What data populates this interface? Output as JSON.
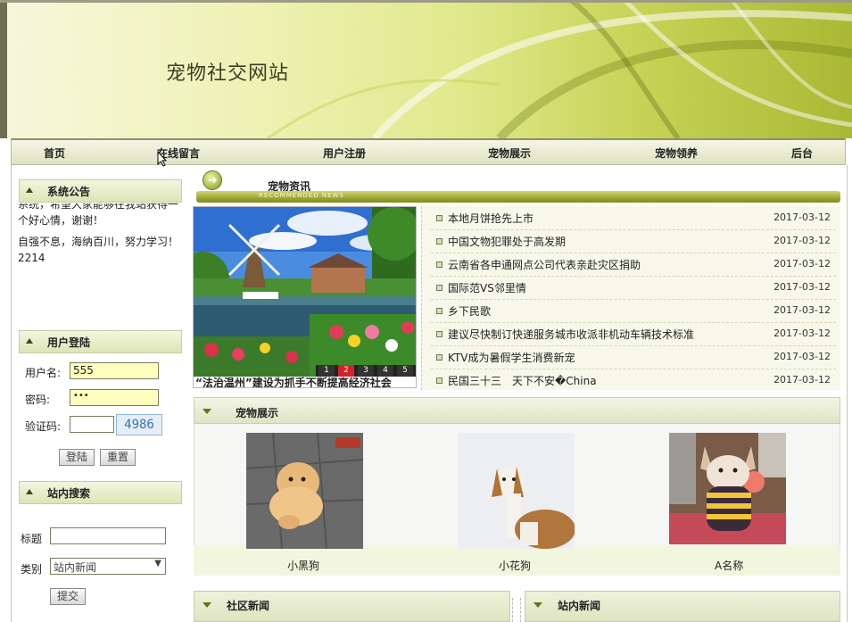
{
  "site_title": "宠物社交网站",
  "nav": [
    "首页",
    "在线留言",
    "用户注册",
    "宠物展示",
    "宠物领养",
    "后台"
  ],
  "sidebar": {
    "notice": {
      "title": "系统公告",
      "lines": [
        "系统，希望大家能够在我站获得一个好心情，谢谢！",
        "自强不息，海纳百川，努力学习！2214"
      ]
    },
    "login": {
      "title": "用户登陆",
      "username_label": "用户名:",
      "username_value": "555",
      "password_label": "密码:",
      "password_value": "•••",
      "captcha_label": "验证码:",
      "captcha_value": "",
      "captcha_code": "4986",
      "login_button": "登陆",
      "reset_button": "重置"
    },
    "search": {
      "title": "站内搜索",
      "title_label": "标题",
      "title_value": "",
      "category_label": "类别",
      "category_value": "站内新闻",
      "submit_button": "提交"
    }
  },
  "news": {
    "title": "宠物资讯",
    "subtitle": "RECOMMENDED NEWS",
    "slide_caption": "“法治温州”建设为抓手不断提高经济社会",
    "slide_pages": [
      "1",
      "2",
      "3",
      "4",
      "5"
    ],
    "slide_active": "2",
    "items": [
      {
        "title": "本地月饼抢先上市",
        "date": "2017-03-12"
      },
      {
        "title": "中国文物犯罪处于高发期",
        "date": "2017-03-12"
      },
      {
        "title": "云南省各申通网点公司代表亲赴灾区捐助",
        "date": "2017-03-12"
      },
      {
        "title": "国际范VS邻里情",
        "date": "2017-03-12"
      },
      {
        "title": "乡下民歌",
        "date": "2017-03-12"
      },
      {
        "title": "建议尽快制订快递服务城市收派非机动车辆技术标准",
        "date": "2017-03-12"
      },
      {
        "title": "KTV成为暑假学生消费新宠",
        "date": "2017-03-12"
      },
      {
        "title": "民国三十三　天下不安�China",
        "date": "2017-03-12"
      }
    ]
  },
  "pets": {
    "title": "宠物展示",
    "items": [
      {
        "name": "小黑狗",
        "icon": "pomeranian-photo"
      },
      {
        "name": "小花狗",
        "icon": "basset-hound-photo"
      },
      {
        "name": "A名称",
        "icon": "chihuahua-photo"
      }
    ]
  },
  "bottom": {
    "community_title": "社区新闻",
    "site_news_title": "站内新闻"
  },
  "colors": {
    "accent": "#7d8a16",
    "banner": "#dfe88a",
    "input_bg": "#fffdbd"
  }
}
